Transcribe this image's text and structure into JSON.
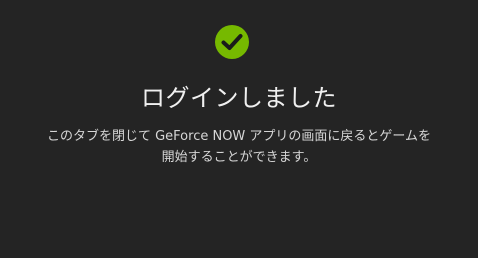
{
  "status": {
    "icon": "check-circle-icon",
    "icon_color": "#76b900"
  },
  "title": "ログインしました",
  "message": {
    "line1": "このタブを閉じて GeForce NOW アプリの画面に戻るとゲームを",
    "line2": "開始することができます。"
  },
  "colors": {
    "background": "#242424",
    "text": "#f0f0f0"
  }
}
